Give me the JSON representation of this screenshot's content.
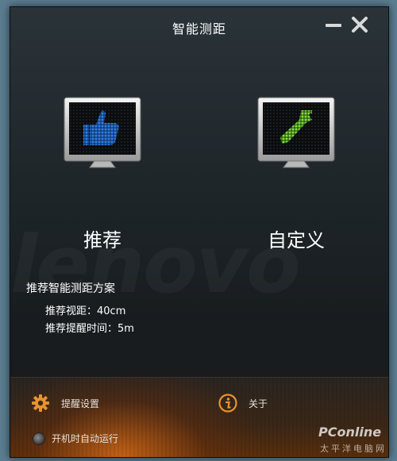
{
  "window": {
    "title": "智能测距"
  },
  "modes": {
    "recommend": {
      "label": "推荐",
      "icon": "thumbs-up-icon",
      "color": "#2f7fe8"
    },
    "custom": {
      "label": "自定义",
      "icon": "wrench-icon",
      "color": "#7fe23a"
    }
  },
  "info": {
    "title": "推荐智能测距方案",
    "distance_line": "推荐视距：40cm",
    "reminder_line": "推荐提醒时间：5m"
  },
  "bottom": {
    "settings_label": "提醒设置",
    "about_label": "关于",
    "autostart_label": "开机时自动运行"
  },
  "watermark": {
    "brand": "lenovo",
    "site_logo": "PConline",
    "site_sub": "太平洋电脑网"
  },
  "colors": {
    "accent_orange": "#d86b18",
    "window_bg": "#1d2428"
  }
}
